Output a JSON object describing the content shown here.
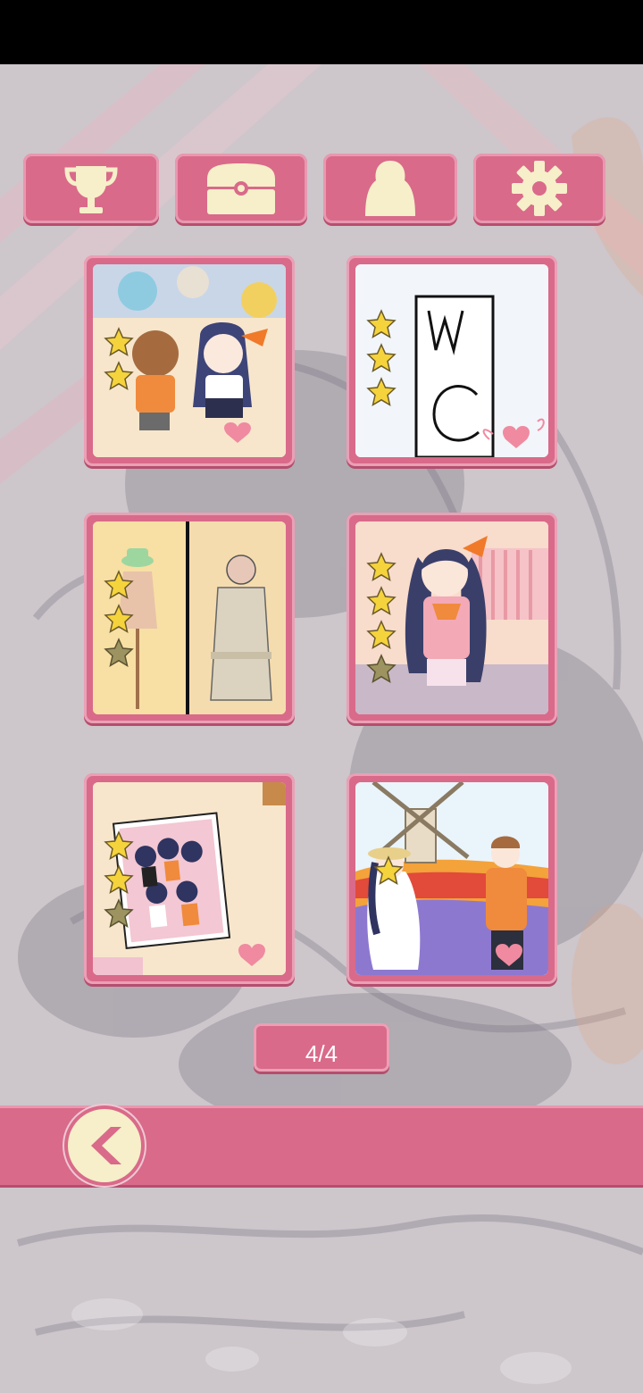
{
  "toolbar": {
    "buttons": [
      {
        "id": "trophy",
        "icon": "trophy-icon"
      },
      {
        "id": "chest",
        "icon": "treasure-chest-icon"
      },
      {
        "id": "character",
        "icon": "character-icon"
      },
      {
        "id": "settings",
        "icon": "gear-icon"
      }
    ]
  },
  "levels": [
    {
      "scene": "chibi-group",
      "stars_earned": 2,
      "stars_shown": 2
    },
    {
      "scene": "wc-door",
      "stars_earned": 3,
      "stars_shown": 3
    },
    {
      "scene": "dress-mannequins",
      "stars_earned": 2,
      "stars_shown": 3
    },
    {
      "scene": "girl-bedroom",
      "stars_earned": 3,
      "stars_shown": 4
    },
    {
      "scene": "group-photo",
      "stars_earned": 2,
      "stars_shown": 3
    },
    {
      "scene": "windmill-field",
      "stars_earned": 1,
      "stars_shown": 1
    }
  ],
  "pagination": {
    "label": "4/4",
    "current": 4,
    "total": 4
  },
  "nav": {
    "back_icon": "chevron-left-icon"
  },
  "colors": {
    "accent": "#d96a8a",
    "cream": "#f6efc9",
    "star_gold": "#f5d33c",
    "star_empty": "#9c9360"
  }
}
